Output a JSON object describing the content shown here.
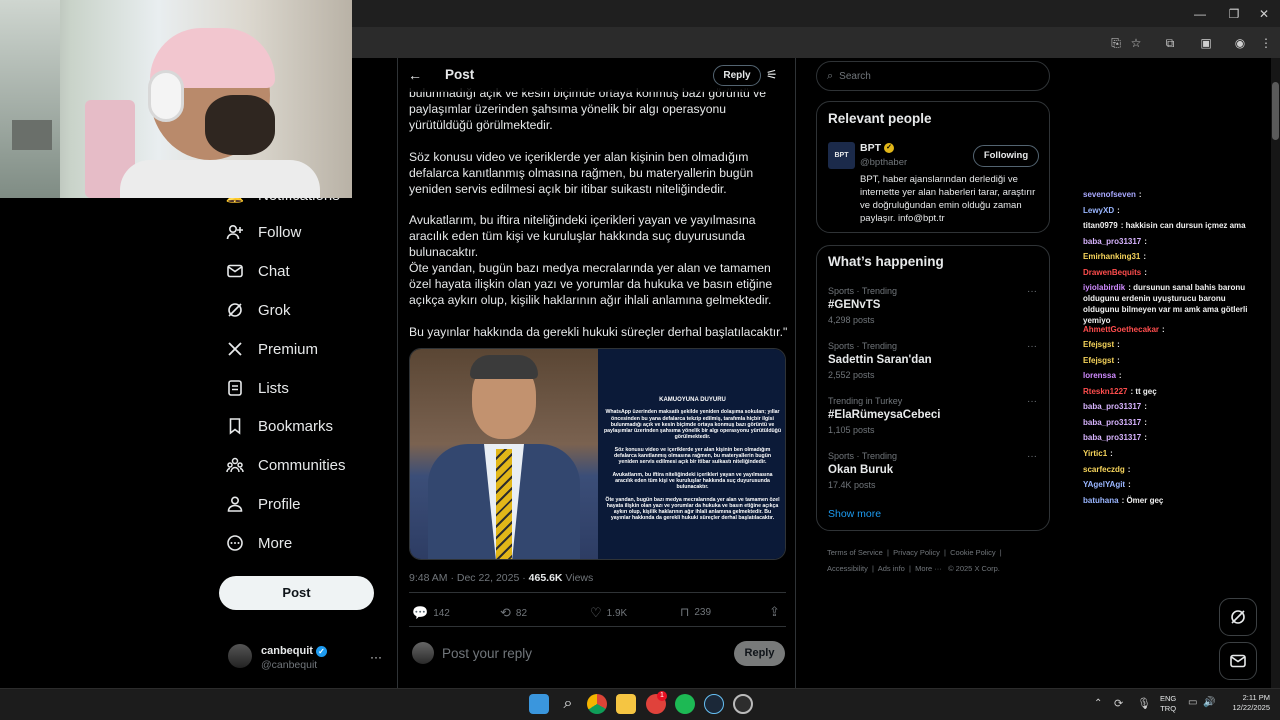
{
  "header": {
    "title": "Post",
    "reply_label": "Reply"
  },
  "nav": {
    "partial_label": "Notifications",
    "items": [
      {
        "label": "Follow"
      },
      {
        "label": "Chat"
      },
      {
        "label": "Grok"
      },
      {
        "label": "Premium"
      },
      {
        "label": "Lists"
      },
      {
        "label": "Bookmarks"
      },
      {
        "label": "Communities"
      },
      {
        "label": "Profile"
      },
      {
        "label": "More"
      }
    ],
    "post_button": "Post",
    "account": {
      "name": "canbequit",
      "handle": "@canbequit"
    }
  },
  "post": {
    "paragraphs": [
      "bulunmadığı açık ve kesin biçimde ortaya konmuş bazı görüntü ve paylaşımlar üzerinden şahsıma yönelik bir algı operasyonu yürütüldüğü görülmektedir.",
      "Söz konusu video ve içeriklerde yer alan kişinin ben olmadığım defalarca kanıtlanmış olmasına rağmen, bu materyallerin bugün yeniden servis edilmesi açık bir itibar suikastı niteliğindedir.",
      "Avukatlarım, bu iftira niteliğindeki içerikleri yayan ve yayılmasına aracılık eden tüm kişi ve kuruluşlar hakkında suç duyurusunda bulunacaktır.",
      "Öte yandan, bugün bazı medya mecralarında yer alan ve tamamen özel hayata ilişkin olan yazı ve yorumlar da hukuka ve basın etiğine açıkça aykırı olup, kişilik haklarının ağır ihlali anlamına gelmektedir.",
      "Bu yayınlar hakkında da gerekli hukuki süreçler derhal başlatılacaktır.\""
    ],
    "image_text": {
      "title": "KAMUOYUNA DUYURU",
      "p1": "WhatsApp üzerinden maksatlı şekilde yeniden dolaşıma sokulan; yıllar öncesinden bu yana defalarca tekzip edilmiş, tarafımla hiçbir ilgisi bulunmadığı açık ve kesin biçimde ortaya konmuş bazı görüntü ve paylaşımlar üzerinden şahsıma yönelik bir algı operasyonu yürütüldüğü görülmektedir.",
      "p2": "Söz konusu video ve içeriklerde yer alan kişinin ben olmadığım defalarca kanıtlanmış olmasına rağmen, bu materyallerin bugün yeniden servis edilmesi açık bir itibar suikastı niteliğindedir.",
      "p3": "Avukatlarım, bu iftira niteliğindeki içerikleri yayan ve yayılmasına aracılık eden tüm kişi ve kuruluşlar hakkında suç duyurusunda bulunacaktır.",
      "p4": "Öte yandan, bugün bazı medya mecralarında yer alan ve tamamen özel hayata ilişkin olan yazı ve yorumlar da hukuka ve basın etiğine açıkça aykırı olup, kişilik haklarının ağır ihlali anlamına gelmektedir. Bu yayınlar hakkında da gerekli hukuki süreçler derhal başlatılacaktır."
    },
    "timestamp": "9:48 AM · Dec 22, 2025 · ",
    "views_count": "465.6K",
    "views_label": " Views",
    "stats": {
      "replies": "142",
      "reposts": "82",
      "likes": "1.9K",
      "bookmarks": "239"
    },
    "reply_placeholder": "Post your reply",
    "reply_button": "Reply"
  },
  "right": {
    "search_placeholder": "Search",
    "relevant_title": "Relevant people",
    "person": {
      "name": "BPT",
      "handle": "@bpthaber",
      "follow_label": "Following",
      "avatar_text": "BPT",
      "bio": "BPT, haber ajanslarından derlediği ve internette yer alan haberleri tarar, araştırır ve doğruluğundan emin olduğu zaman paylaşır. info@bpt.tr"
    },
    "happening_title": "What’s happening",
    "trends": [
      {
        "category": "Sports · Trending",
        "name": "#GENvTS",
        "count": "4,298 posts"
      },
      {
        "category": "Sports · Trending",
        "name": "Sadettin Saran'dan",
        "count": "2,552 posts"
      },
      {
        "category": "Trending in Turkey",
        "name": "#ElaRümeysaCebeci",
        "count": "1,105 posts"
      },
      {
        "category": "Sports · Trending",
        "name": "Okan Buruk",
        "count": "17.4K posts"
      }
    ],
    "show_more": "Show more",
    "footer": [
      "Terms of Service",
      "Privacy Policy",
      "Cookie Policy",
      "Accessibility",
      "Ads info",
      "More ···",
      "© 2025 X Corp."
    ]
  },
  "chat": [
    {
      "user": "sevenofseven",
      "color": "#a9a9ff",
      "msg": ":"
    },
    {
      "user": "LewyXD",
      "color": "#9ab6ff",
      "msg": ":"
    },
    {
      "user": "titan0979",
      "color": "#f0f0f0",
      "msg": ": hakkisin can dursun içmez ama"
    },
    {
      "user": "baba_pro31317",
      "color": "#d8b4ff",
      "msg": ":"
    },
    {
      "user": "Emirhanking31",
      "color": "#f7d55c",
      "msg": ":"
    },
    {
      "user": "DrawenBequits",
      "color": "#ff4d4d",
      "msg": ":"
    },
    {
      "user": "iyiolabirdik",
      "color": "#d08bff",
      "msg": ": dursunun sanal bahis baronu oldugunu erdenin uyuşturucu baronu oldugunu bilmeyen var mı amk ama götlerli yemiyo"
    },
    {
      "user": "AhmettGoethecakar",
      "color": "#ff4d4d",
      "msg": ":"
    },
    {
      "user": "Efejsgst",
      "color": "#f7d55c",
      "msg": ":"
    },
    {
      "user": "Efejsgst",
      "color": "#f7d55c",
      "msg": ":"
    },
    {
      "user": "lorenssa",
      "color": "#d08bff",
      "msg": ":"
    },
    {
      "user": "Rteskn1227",
      "color": "#ff4d4d",
      "msg": ": tt geç"
    },
    {
      "user": "baba_pro31317",
      "color": "#d8b4ff",
      "msg": ":"
    },
    {
      "user": "baba_pro31317",
      "color": "#d8b4ff",
      "msg": ":"
    },
    {
      "user": "baba_pro31317",
      "color": "#d8b4ff",
      "msg": ":"
    },
    {
      "user": "Yirtic1",
      "color": "#f7d55c",
      "msg": ":"
    },
    {
      "user": "scarfeczdg",
      "color": "#f7d55c",
      "msg": ":"
    },
    {
      "user": "YAgelYAgit",
      "color": "#9ab6ff",
      "msg": ":"
    },
    {
      "user": "batuhana",
      "color": "#9ab6ff",
      "msg": ": Ömer geç"
    }
  ],
  "taskbar": {
    "lang": "ENG",
    "region": "TRQ",
    "time": "2:11 PM",
    "date": "12/22/2025",
    "badge": "1"
  },
  "colors": {
    "background": "#000000",
    "text": "#e7e9ea",
    "muted": "#71767b",
    "verified": "#1d9bf0",
    "gold": "#e2b719"
  }
}
